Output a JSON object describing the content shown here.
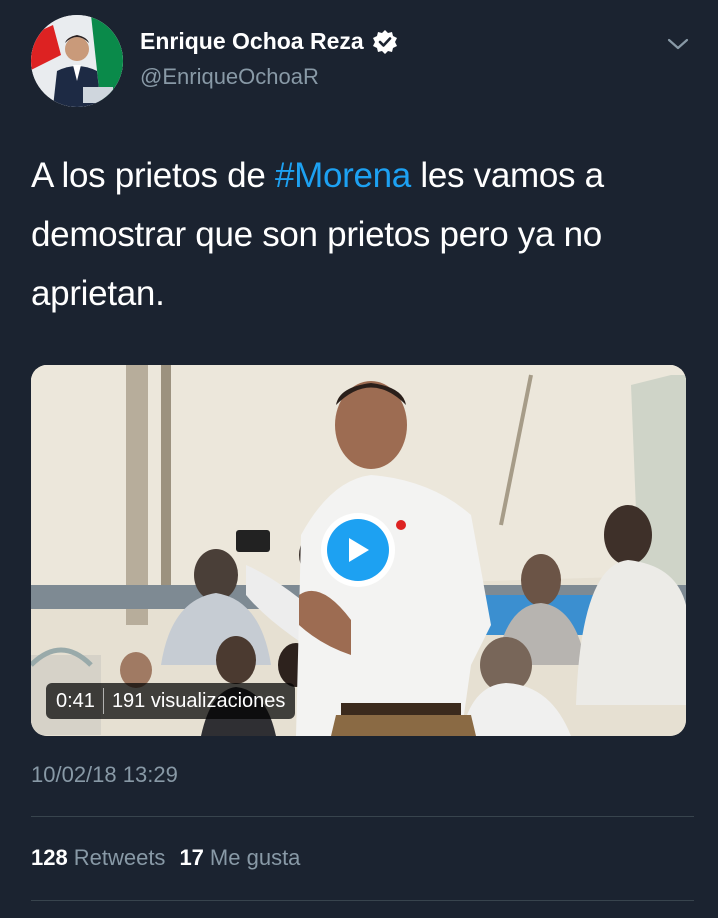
{
  "author": {
    "name": "Enrique Ochoa Reza",
    "handle": "@EnriqueOchoaR",
    "avatar_icon": "profile-photo",
    "verified_icon": "verified-badge-icon"
  },
  "tweet": {
    "text_before": "A los prietos de ",
    "hashtag": "#Morena",
    "text_after": " les vamos a demostrar que son prietos pero ya no aprietan."
  },
  "video": {
    "duration": "0:41",
    "views": "191 visualizaciones",
    "play_icon": "play-icon"
  },
  "timestamp": "10/02/18 13:29",
  "stats": {
    "retweets_count": "128",
    "retweets_label": "Retweets",
    "likes_count": "17",
    "likes_label": "Me gusta"
  },
  "colors": {
    "background": "#1b2330",
    "link": "#1da1f2",
    "secondary_text": "#8899a6",
    "divider": "#38444d"
  }
}
